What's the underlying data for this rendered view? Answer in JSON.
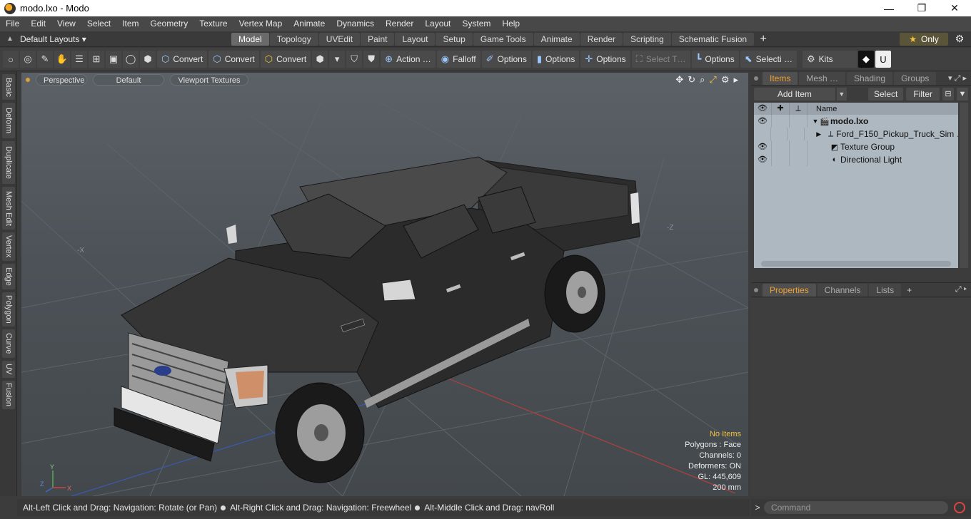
{
  "window": {
    "title": "modo.lxo - Modo",
    "controls": {
      "minimize": "—",
      "maximize": "❐",
      "close": "✕"
    }
  },
  "menu": [
    "File",
    "Edit",
    "View",
    "Select",
    "Item",
    "Geometry",
    "Texture",
    "Vertex Map",
    "Animate",
    "Dynamics",
    "Render",
    "Layout",
    "System",
    "Help"
  ],
  "layout_bar": {
    "layouts_label": "Default Layouts ▾",
    "tabs": [
      "Model",
      "Topology",
      "UVEdit",
      "Paint",
      "Layout",
      "Setup",
      "Game Tools",
      "Animate",
      "Render",
      "Scripting",
      "Schematic Fusion"
    ],
    "active_tab": "Model",
    "add": "+",
    "only_label": "Only",
    "gear": "⚙"
  },
  "toolbar": {
    "convert1": "Convert",
    "convert2": "Convert",
    "convert3": "Convert",
    "action": "Action …",
    "falloff": "Falloff",
    "options1": "Options",
    "options2": "Options",
    "options3": "Options",
    "select_t": "Select T…",
    "options4": "Options",
    "selecti": "Selecti …",
    "kits": "Kits"
  },
  "side_tabs": [
    "Basic",
    "Deform",
    "Duplicate",
    "Mesh Edit",
    "Vertex",
    "Edge",
    "Polygon",
    "Curve",
    "UV",
    "Fusion"
  ],
  "viewport": {
    "perspective": "Perspective",
    "default": "Default",
    "textures": "Viewport Textures",
    "axis_x": "-X",
    "axis_z": "-Z",
    "stats": {
      "items": "No Items",
      "polygons": "Polygons : Face",
      "channels": "Channels: 0",
      "deformers": "Deformers: ON",
      "gl": "GL: 445,609",
      "scale": "200 mm"
    },
    "colors": {
      "accent": "#f0c040",
      "truck_body": "#2a2a2a",
      "grid_red": "#b04040"
    }
  },
  "statusbar": {
    "part1": "Alt-Left Click and Drag: Navigation: Rotate (or Pan)",
    "part2": "Alt-Right Click and Drag: Navigation: Freewheel",
    "part3": "Alt-Middle Click and Drag: navRoll"
  },
  "items_panel": {
    "tabs": [
      "Items",
      "Mesh …",
      "Shading",
      "Groups"
    ],
    "active_tab": "Items",
    "add_item": "Add Item",
    "select": "Select",
    "filter": "Filter",
    "header_name": "Name",
    "rows": [
      {
        "name": "modo.lxo",
        "visible": true,
        "bold": true,
        "expander": "▼",
        "icon": "scene-icon"
      },
      {
        "name": "Ford_F150_Pickup_Truck_Sim …",
        "visible": false,
        "bold": false,
        "expander": "▶",
        "icon": "mesh-icon"
      },
      {
        "name": "Texture Group",
        "visible": true,
        "bold": false,
        "expander": "",
        "icon": "texture-group-icon"
      },
      {
        "name": "Directional Light",
        "visible": true,
        "bold": false,
        "expander": "",
        "icon": "light-icon"
      }
    ]
  },
  "props_panel": {
    "tabs": [
      "Properties",
      "Channels",
      "Lists"
    ],
    "active_tab": "Properties",
    "add": "+"
  },
  "command": {
    "placeholder": "Command",
    "prompt": ">"
  }
}
